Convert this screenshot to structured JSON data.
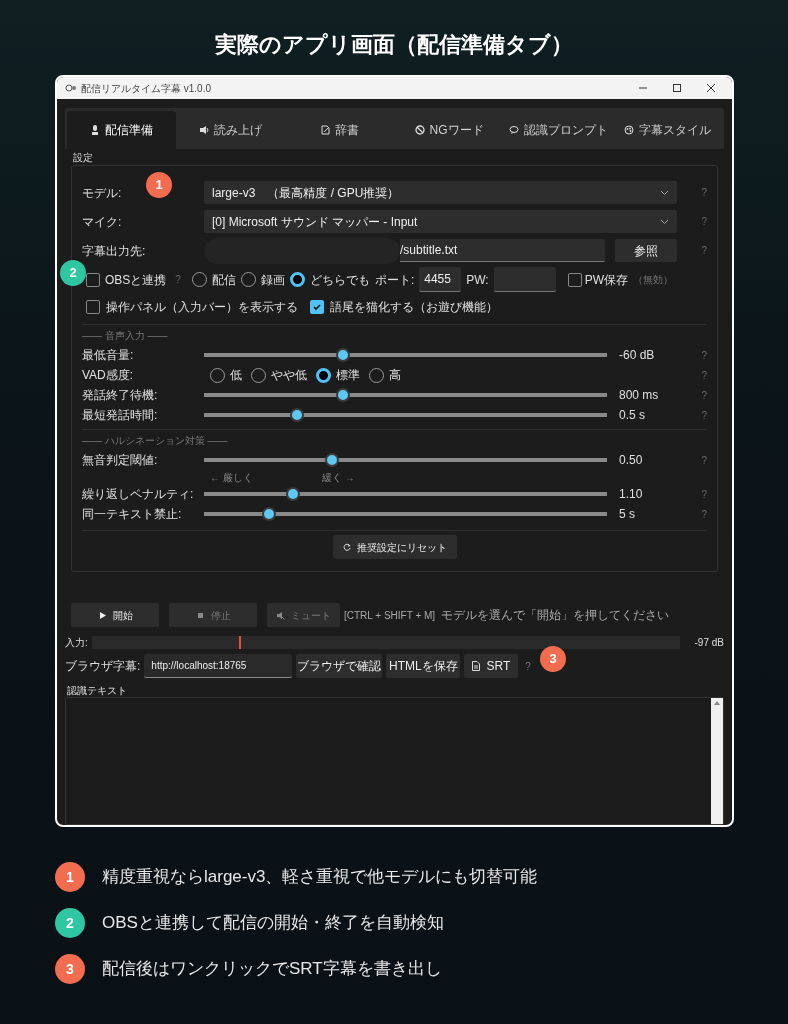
{
  "heading": "実際のアプリ画面（配信準備タブ）",
  "window": {
    "title": "配信リアルタイム字幕  v1.0.0"
  },
  "tabs": [
    {
      "label": "配信準備",
      "selected": true
    },
    {
      "label": "読み上げ",
      "selected": false
    },
    {
      "label": "辞書",
      "selected": false
    },
    {
      "label": "NGワード",
      "selected": false
    },
    {
      "label": "認識プロンプト",
      "selected": false
    },
    {
      "label": "字幕スタイル",
      "selected": false
    }
  ],
  "settings": {
    "title": "設定",
    "fields": [
      {
        "kind": "select",
        "label": "モデル:",
        "value": "large-v3　（最高精度 / GPU推奨）",
        "help": "?"
      },
      {
        "kind": "select",
        "label": "マイク:",
        "value": "[0] Microsoft サウンド マッパー - Input",
        "help": "?"
      },
      {
        "kind": "path",
        "label": "字幕出力先:",
        "value": "/subtitle.txt",
        "button": "参照",
        "help": "?"
      }
    ],
    "obs": {
      "label": "OBSと連携",
      "checked": false,
      "help": "?",
      "modes": [
        {
          "label": "配信",
          "selected": false
        },
        {
          "label": "録画",
          "selected": false
        },
        {
          "label": "どちらでも",
          "selected": true
        }
      ],
      "port_label": "ポート:",
      "port": "4455",
      "pw_label": "PW:",
      "pw_save": {
        "label": "PW保存",
        "checked": false
      },
      "note": "（無効）"
    },
    "options": [
      {
        "label": "操作パネル（入力バー）を表示する",
        "checked": false
      },
      {
        "label": "語尾を猫化する（お遊び機能）",
        "checked": true
      }
    ],
    "sections": [
      {
        "title": "—— 音声入力 ——",
        "rows": [
          {
            "kind": "slider",
            "label": "最低音量:",
            "level": 0.34,
            "reading": "-60 dB",
            "help": "?"
          },
          {
            "kind": "radio",
            "label": "VAD感度:",
            "options": [
              {
                "label": "低",
                "selected": false
              },
              {
                "label": "やや低",
                "selected": false
              },
              {
                "label": "標準",
                "selected": true
              },
              {
                "label": "高",
                "selected": false
              }
            ],
            "help": "?"
          },
          {
            "kind": "slider",
            "label": "発話終了待機:",
            "level": 0.34,
            "reading": "800 ms",
            "help": "?"
          },
          {
            "kind": "slider",
            "label": "最短発話時間:",
            "level": 0.22,
            "reading": "0.5 s",
            "help": "?"
          }
        ]
      },
      {
        "title": "—— ハルシネーション対策 ——",
        "rows": [
          {
            "kind": "slider",
            "label": "無音判定閾値:",
            "level": 0.31,
            "reading": "0.50",
            "help": "?"
          },
          {
            "kind": "hints",
            "left": "← 厳しく",
            "right": "緩く →"
          },
          {
            "kind": "slider",
            "label": "繰り返しペナルティ:",
            "level": 0.21,
            "reading": "1.10",
            "help": "?"
          },
          {
            "kind": "slider",
            "label": "同一テキスト禁止:",
            "level": 0.15,
            "reading": "5 s",
            "help": "?"
          }
        ]
      }
    ],
    "reset_button": "推奨設定にリセット"
  },
  "controls": {
    "buttons": [
      {
        "label": "開始",
        "disabled": false
      },
      {
        "label": "停止",
        "disabled": true
      },
      {
        "label": "ミュート",
        "disabled": true
      }
    ],
    "hotkey": "[CTRL + SHIFT + M]",
    "status": "モデルを選んで「開始」を押してください"
  },
  "input_meter": {
    "label": "入力:",
    "level": 0.25,
    "reading": "-97 dB"
  },
  "browser": {
    "label": "ブラウザ字幕:",
    "url": "http://localhost:18765",
    "buttons": [
      "ブラウザで確認",
      "HTMLを保存",
      "SRT"
    ],
    "help": "?"
  },
  "transcript": {
    "title": "認識テキスト"
  },
  "markers": [
    {
      "number": "1",
      "color": "#f26d50"
    },
    {
      "number": "2",
      "color": "#2fc7a2"
    },
    {
      "number": "3",
      "color": "#f26d50"
    }
  ],
  "callouts": [
    {
      "number": "1",
      "color": "#f26d50",
      "text": "精度重視ならlarge-v3、軽さ重視で他モデルにも切替可能"
    },
    {
      "number": "2",
      "color": "#2fc7a2",
      "text": "OBSと連携して配信の開始・終了を自動検知"
    },
    {
      "number": "3",
      "color": "#f26d50",
      "text": "配信後はワンクリックでSRT字幕を書き出し"
    }
  ]
}
